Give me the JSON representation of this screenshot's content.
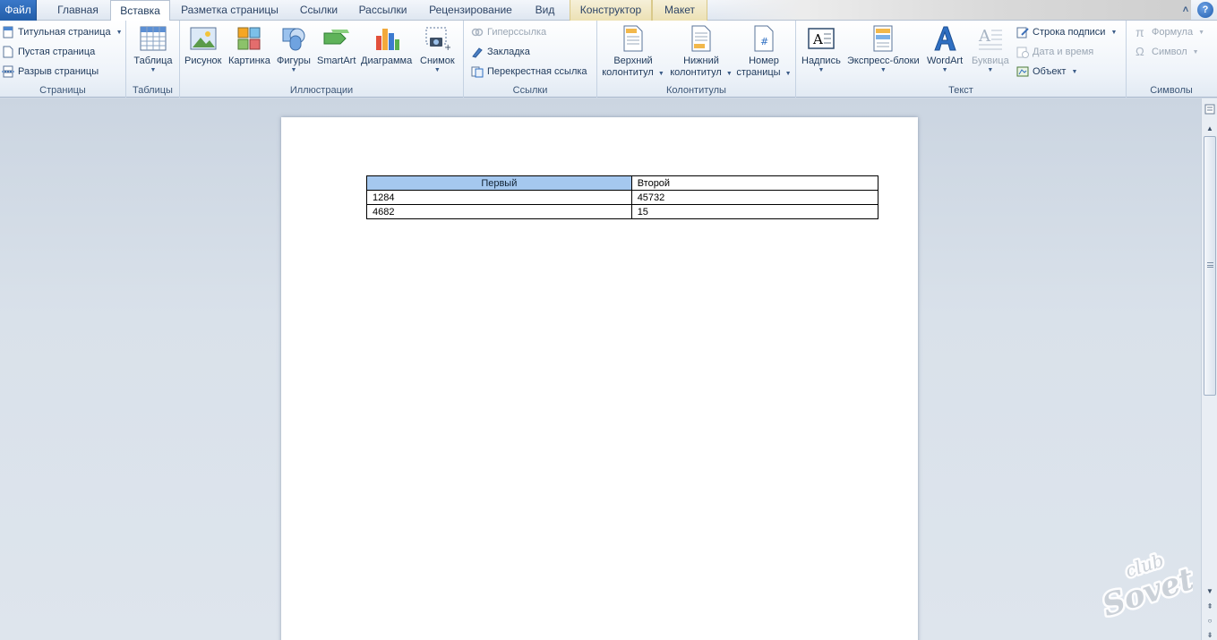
{
  "tabs": [
    {
      "label": "Файл"
    },
    {
      "label": "Главная"
    },
    {
      "label": "Вставка"
    },
    {
      "label": "Разметка страницы"
    },
    {
      "label": "Ссылки"
    },
    {
      "label": "Рассылки"
    },
    {
      "label": "Рецензирование"
    },
    {
      "label": "Вид"
    },
    {
      "label": "Конструктор"
    },
    {
      "label": "Макет"
    }
  ],
  "ribbon": {
    "pages": {
      "label": "Страницы",
      "cover": "Титульная страница",
      "blank": "Пустая страница",
      "break": "Разрыв страницы"
    },
    "tables": {
      "label": "Таблицы",
      "table": "Таблица"
    },
    "illustrations": {
      "label": "Иллюстрации",
      "picture": "Рисунок",
      "clipart": "Картинка",
      "shapes": "Фигуры",
      "smartart": "SmartArt",
      "chart": "Диаграмма",
      "screenshot": "Снимок"
    },
    "links": {
      "label": "Ссылки",
      "hyperlink": "Гиперссылка",
      "bookmark": "Закладка",
      "crossref": "Перекрестная ссылка"
    },
    "headerfooter": {
      "label": "Колонтитулы",
      "header_l1": "Верхний",
      "header_l2": "колонтитул",
      "footer_l1": "Нижний",
      "footer_l2": "колонтитул",
      "pagenum_l1": "Номер",
      "pagenum_l2": "страницы"
    },
    "text": {
      "label": "Текст",
      "textbox": "Надпись",
      "quickparts": "Экспресс-блоки",
      "wordart": "WordArt",
      "dropcap": "Буквица",
      "signature": "Строка подписи",
      "datetime": "Дата и время",
      "object": "Объект"
    },
    "symbols": {
      "label": "Символы",
      "equation": "Формула",
      "symbol": "Символ"
    }
  },
  "document": {
    "table": [
      [
        "Первый",
        "Второй"
      ],
      [
        "1284",
        "45732"
      ],
      [
        "4682",
        "15"
      ]
    ]
  },
  "watermark": {
    "line1": "club",
    "line2": "Sovet"
  },
  "colors": {
    "file_tab": "#2a66b3",
    "selection": "#a5c8ef",
    "ribbon_bg": "#eef3f9",
    "workspace_bg": "#d2dbe6"
  }
}
